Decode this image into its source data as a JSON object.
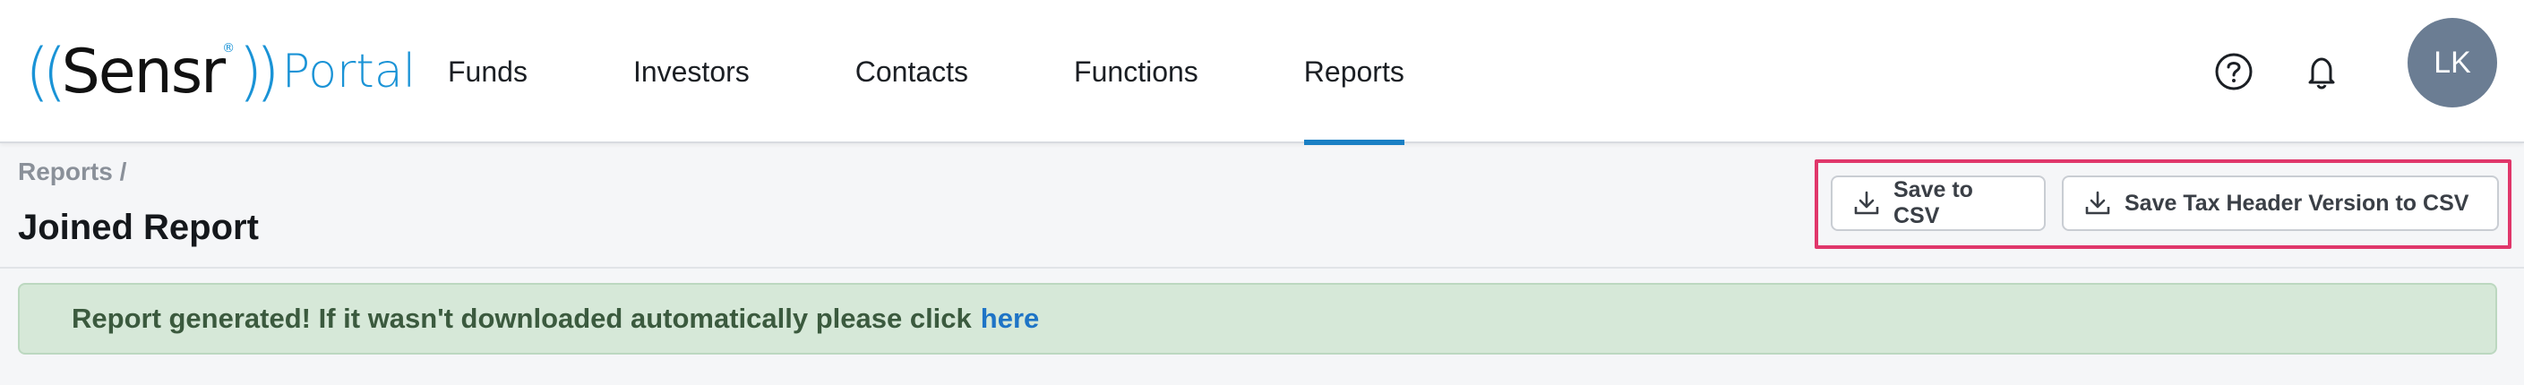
{
  "logo": {
    "open": "((",
    "brand": "Sensr",
    "close": "))",
    "reg": "®",
    "portal": "Portal"
  },
  "nav": [
    {
      "label": "Funds"
    },
    {
      "label": "Investors"
    },
    {
      "label": "Contacts"
    },
    {
      "label": "Functions"
    },
    {
      "label": "Reports",
      "active": true
    }
  ],
  "header_icons": {
    "help": "help-circle-icon",
    "notifications": "bell-icon"
  },
  "user": {
    "initials": "LK",
    "avatar_color": "#6b7d93"
  },
  "breadcrumb": {
    "text": "Reports /"
  },
  "page": {
    "title": "Joined Report"
  },
  "toolbar": {
    "save_csv_label": "Save to CSV",
    "save_tax_csv_label": "Save Tax Header Version to CSV",
    "download_icon": "download-icon"
  },
  "alert": {
    "message": "Report generated! If it wasn't downloaded automatically please click",
    "link_text": "here"
  },
  "colors": {
    "accent": "#1a7fc4",
    "brand": "#1a93d6",
    "highlight": "#e0376b",
    "alert_bg": "#d6e8d8"
  }
}
